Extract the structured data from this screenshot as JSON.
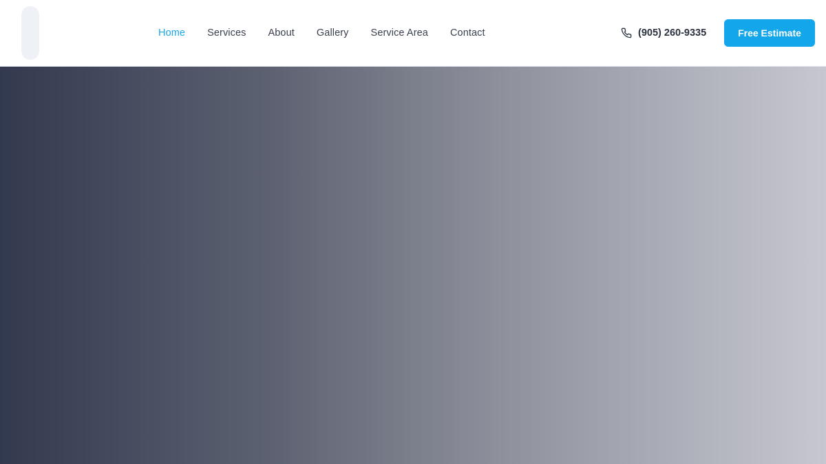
{
  "header": {
    "nav": [
      {
        "label": "Home",
        "active": true
      },
      {
        "label": "Services",
        "active": false
      },
      {
        "label": "About",
        "active": false
      },
      {
        "label": "Gallery",
        "active": false
      },
      {
        "label": "Service Area",
        "active": false
      },
      {
        "label": "Contact",
        "active": false
      }
    ],
    "phone": {
      "icon": "phone-icon",
      "text": "(905) 260-9335"
    },
    "cta_label": "Free Estimate"
  },
  "colors": {
    "accent": "#14a6ea",
    "active_link": "#1aa6e4",
    "nav_text": "#3a4050",
    "hero_gradient_start": "#333a4f",
    "hero_gradient_end": "#c6c7d0"
  }
}
